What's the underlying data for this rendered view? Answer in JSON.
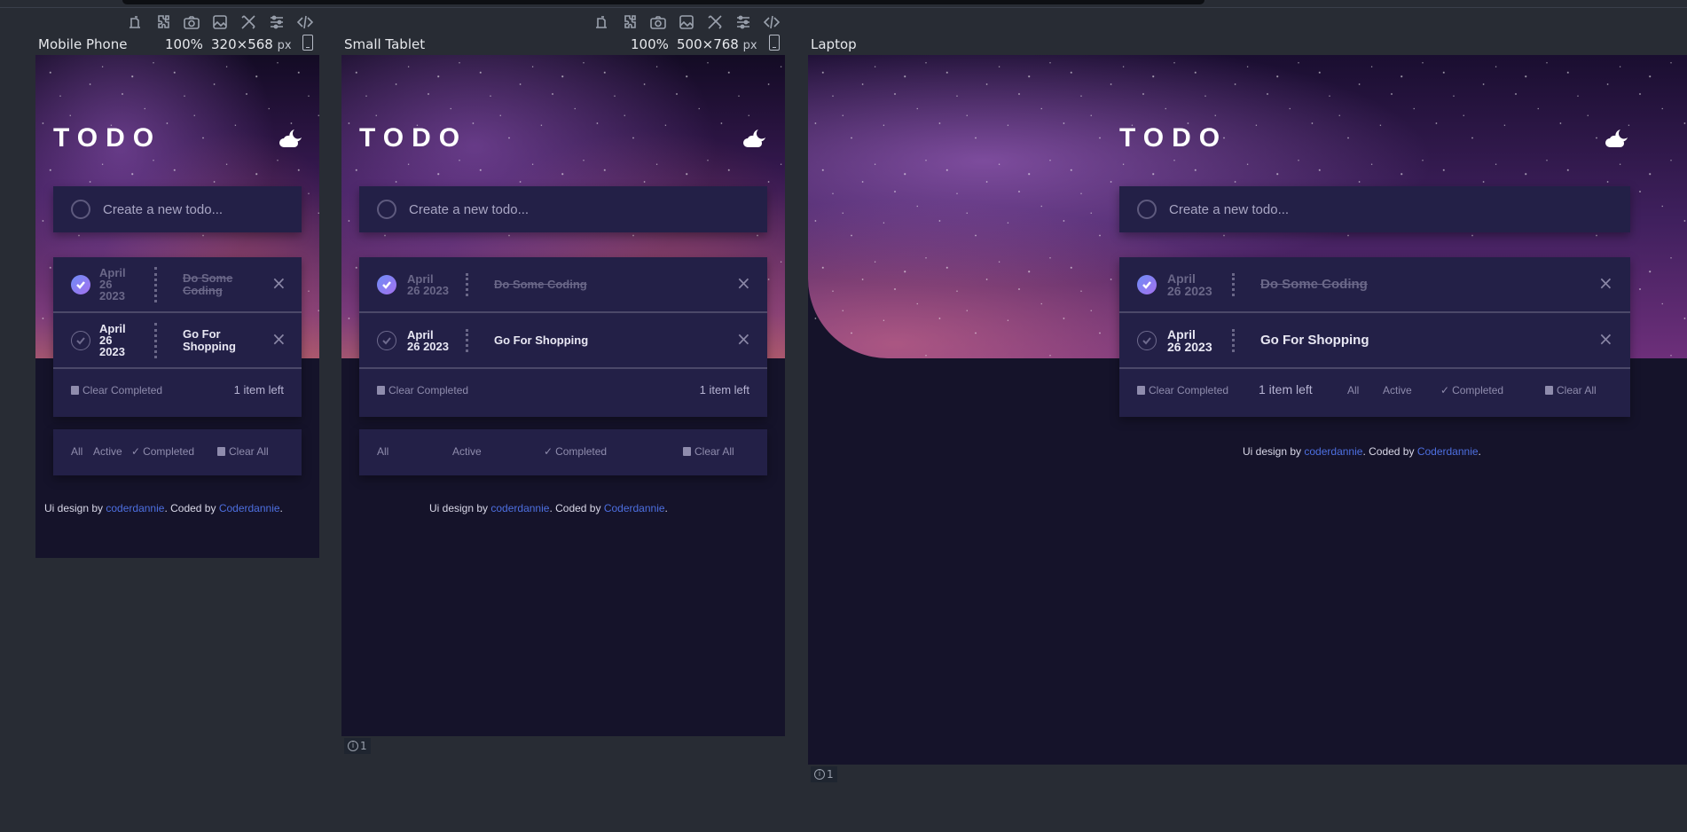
{
  "devices": [
    {
      "name": "Mobile Phone",
      "zoom": "100%",
      "dims": "320×568",
      "unit": "px"
    },
    {
      "name": "Small Tablet",
      "zoom": "100%",
      "dims": "500×768",
      "unit": "px"
    },
    {
      "name": "Laptop"
    }
  ],
  "app": {
    "title": "TODO",
    "new_todo_placeholder": "Create a new todo...",
    "todos": [
      {
        "date_month": "April",
        "date_day": "26",
        "date_year": "2023",
        "date_line2": "26 2023",
        "text": "Do Some Coding",
        "completed": true
      },
      {
        "date_month": "April",
        "date_day": "26",
        "date_year": "2023",
        "date_line2": "26 2023",
        "text": "Go For Shopping",
        "completed": false
      }
    ],
    "mobile_text_lines": [
      [
        "Do Some",
        "Coding"
      ],
      [
        "Go For",
        "Shopping"
      ]
    ],
    "clear_completed": "Clear Completed",
    "items_left": "1 item left",
    "filters": {
      "all": "All",
      "active": "Active",
      "completed": "Completed",
      "clear_all": "Clear All"
    },
    "footer": {
      "prefix": "Ui design by ",
      "designer": "coderdannie",
      "mid": ". Coded by ",
      "coder": "Coderdannie",
      "end": "."
    },
    "close_symbol": "×"
  },
  "badges": {
    "issues_count": "1"
  },
  "colors": {
    "accent_link": "#4d6fe0",
    "card_bg": "#232047",
    "page_bg": "#15132a",
    "check_gradient_start": "#6e8cf6",
    "check_gradient_end": "#a571ef"
  }
}
